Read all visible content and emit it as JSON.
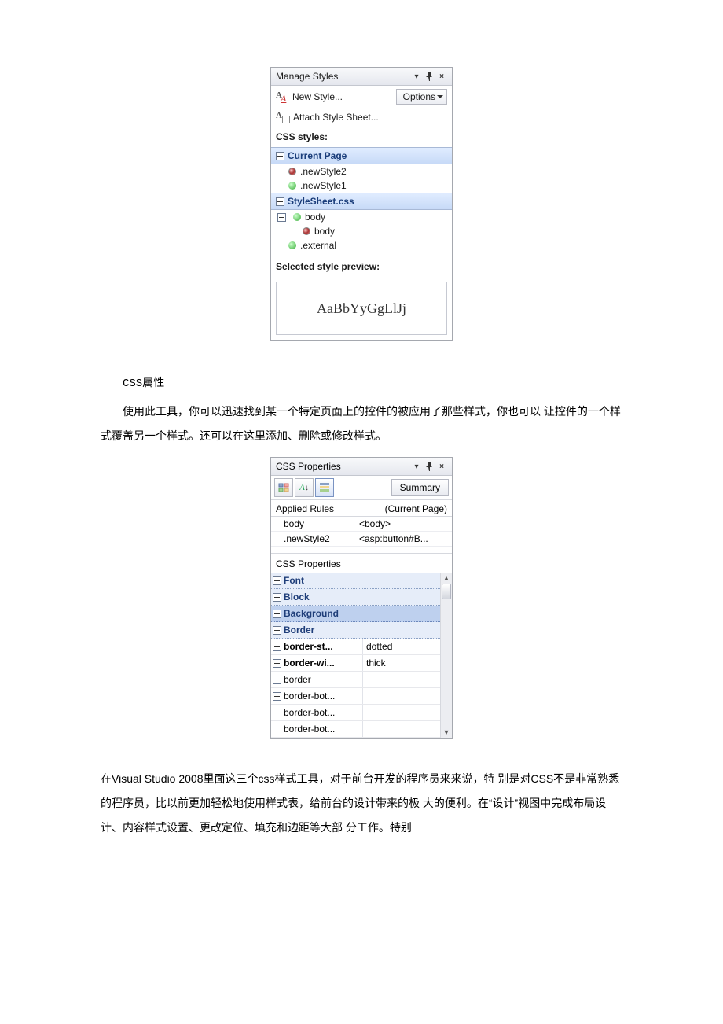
{
  "manageStyles": {
    "title": "Manage Styles",
    "newStyle": "New Style...",
    "options": "Options",
    "attach": "Attach Style Sheet...",
    "cssStylesLabel": "CSS styles:",
    "groups": [
      {
        "title": "Current Page",
        "items": [
          {
            "text": ".newStyle2",
            "kind": "selected"
          },
          {
            "text": ".newStyle1",
            "kind": "green"
          }
        ]
      },
      {
        "title": "StyleSheet.css",
        "items": [
          {
            "text": "body",
            "kind": "green",
            "hasChild": true
          },
          {
            "text": "body",
            "kind": "selected",
            "sub": true
          },
          {
            "text": ".external",
            "kind": "green"
          }
        ]
      }
    ],
    "previewLabel": "Selected style preview:",
    "previewText": "AaBbYyGgLlJj"
  },
  "prose": {
    "heading": "CSS属性",
    "p1": "使用此工具，你可以迅速找到某一个特定页面上的控件的被应用了那些样式，你也可以 让控件的一个样式覆盖另一个样式。还可以在这里添加、删除或修改样式。"
  },
  "cssProps": {
    "title": "CSS Properties",
    "summary": "Summary",
    "appliedRules": "Applied Rules",
    "currentPage": "(Current Page)",
    "rules": [
      {
        "sel": "body",
        "elem": "<body>"
      },
      {
        "sel": ".newStyle2",
        "elem": "<asp:button#B..."
      }
    ],
    "subLabel": "CSS Properties",
    "cats": [
      {
        "name": "Font",
        "exp": "plus"
      },
      {
        "name": "Block",
        "exp": "plus"
      },
      {
        "name": "Background",
        "exp": "plus",
        "sel": true
      },
      {
        "name": "Border",
        "exp": "minus"
      }
    ],
    "props": [
      {
        "n": "border-st...",
        "v": "dotted",
        "exp": "plus",
        "bold": true
      },
      {
        "n": "border-wi...",
        "v": "thick",
        "exp": "plus",
        "bold": true
      },
      {
        "n": "border",
        "v": "",
        "exp": "plus"
      },
      {
        "n": "border-bot...",
        "v": "",
        "exp": "plus"
      },
      {
        "n": "border-bot...",
        "v": ""
      },
      {
        "n": "border-bot...",
        "v": ""
      }
    ]
  },
  "prose2": {
    "p": "在Visual Studio 2008里面这三个css样式工具，对于前台开发的程序员来来说，特 别是对CSS不是非常熟悉的程序员，比以前更加轻松地使用样式表，给前台的设计带来的极 大的便利。在“设计”视图中完成布局设计、内容样式设置、更改定位、填充和边距等大部 分工作。特别"
  }
}
